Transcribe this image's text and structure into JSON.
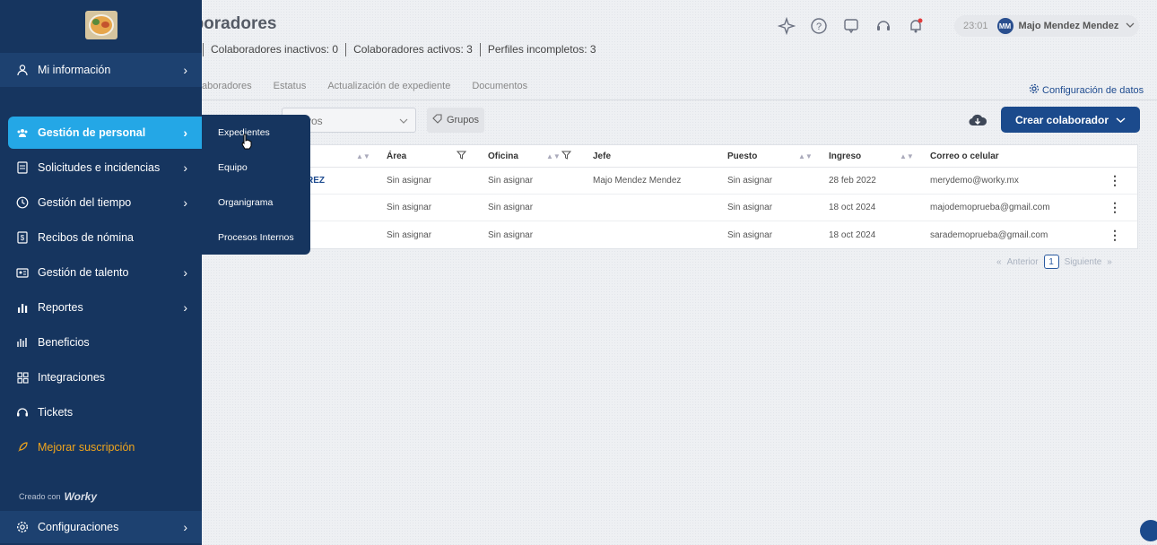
{
  "header": {
    "page_title": "aboradores",
    "stats": [
      "Colaboradores inactivos: 0",
      "Colaboradores activos: 3",
      "Perfiles incompletos: 3"
    ],
    "time": "23:01",
    "avatar_initials": "MM",
    "user_name": "Majo Mendez Mendez"
  },
  "tabs": [
    "aboradores",
    "Estatus",
    "Actualización de expediente",
    "Documentos"
  ],
  "config_link": "Configuración de datos",
  "filters": {
    "select_value": "vos",
    "grupos_label": "Grupos"
  },
  "create_button": "Crear colaborador",
  "table": {
    "headers": {
      "area": "Área",
      "oficina": "Oficina",
      "jefe": "Jefe",
      "puesto": "Puesto",
      "ingreso": "Ingreso",
      "correo": "Correo o celular"
    },
    "rows": [
      {
        "name": "REZ",
        "area": "Sin asignar",
        "oficina": "Sin asignar",
        "jefe": "Majo Mendez Mendez",
        "puesto": "Sin asignar",
        "ingreso": "28 feb 2022",
        "correo": "merydemo@worky.mx"
      },
      {
        "name": "",
        "area": "Sin asignar",
        "oficina": "Sin asignar",
        "jefe": "",
        "puesto": "Sin asignar",
        "ingreso": "18 oct 2024",
        "correo": "majodemoprueba@gmail.com"
      },
      {
        "name": "",
        "area": "Sin asignar",
        "oficina": "Sin asignar",
        "jefe": "",
        "puesto": "Sin asignar",
        "ingreso": "18 oct 2024",
        "correo": "sarademoprueba@gmail.com"
      }
    ]
  },
  "pagination": {
    "prev": "Anterior",
    "page": "1",
    "next": "Siguiente"
  },
  "sidebar": {
    "items": [
      {
        "label": "Mi información",
        "icon": "user-icon"
      },
      {
        "label": "Gestión de personal",
        "icon": "people-icon"
      },
      {
        "label": "Solicitudes e incidencias",
        "icon": "document-icon"
      },
      {
        "label": "Gestión del tiempo",
        "icon": "clock-icon"
      },
      {
        "label": "Recibos de nómina",
        "icon": "receipt-icon"
      },
      {
        "label": "Gestión de talento",
        "icon": "talent-icon"
      },
      {
        "label": "Reportes",
        "icon": "chart-icon"
      },
      {
        "label": "Beneficios",
        "icon": "benefits-icon"
      },
      {
        "label": "Integraciones",
        "icon": "grid-icon"
      },
      {
        "label": "Tickets",
        "icon": "headset-icon"
      },
      {
        "label": "Mejorar suscripción",
        "icon": "rocket-icon"
      }
    ],
    "creado_con": "Creado con",
    "brand": "Worky",
    "config_label": "Configuraciones"
  },
  "submenu": [
    "Expedientes",
    "Equipo",
    "Organigrama",
    "Procesos Internos"
  ],
  "colors": {
    "sidebar": "#16355f",
    "active": "#24a7e6",
    "primary": "#1b4a8c",
    "upgrade": "#f0a51c"
  }
}
